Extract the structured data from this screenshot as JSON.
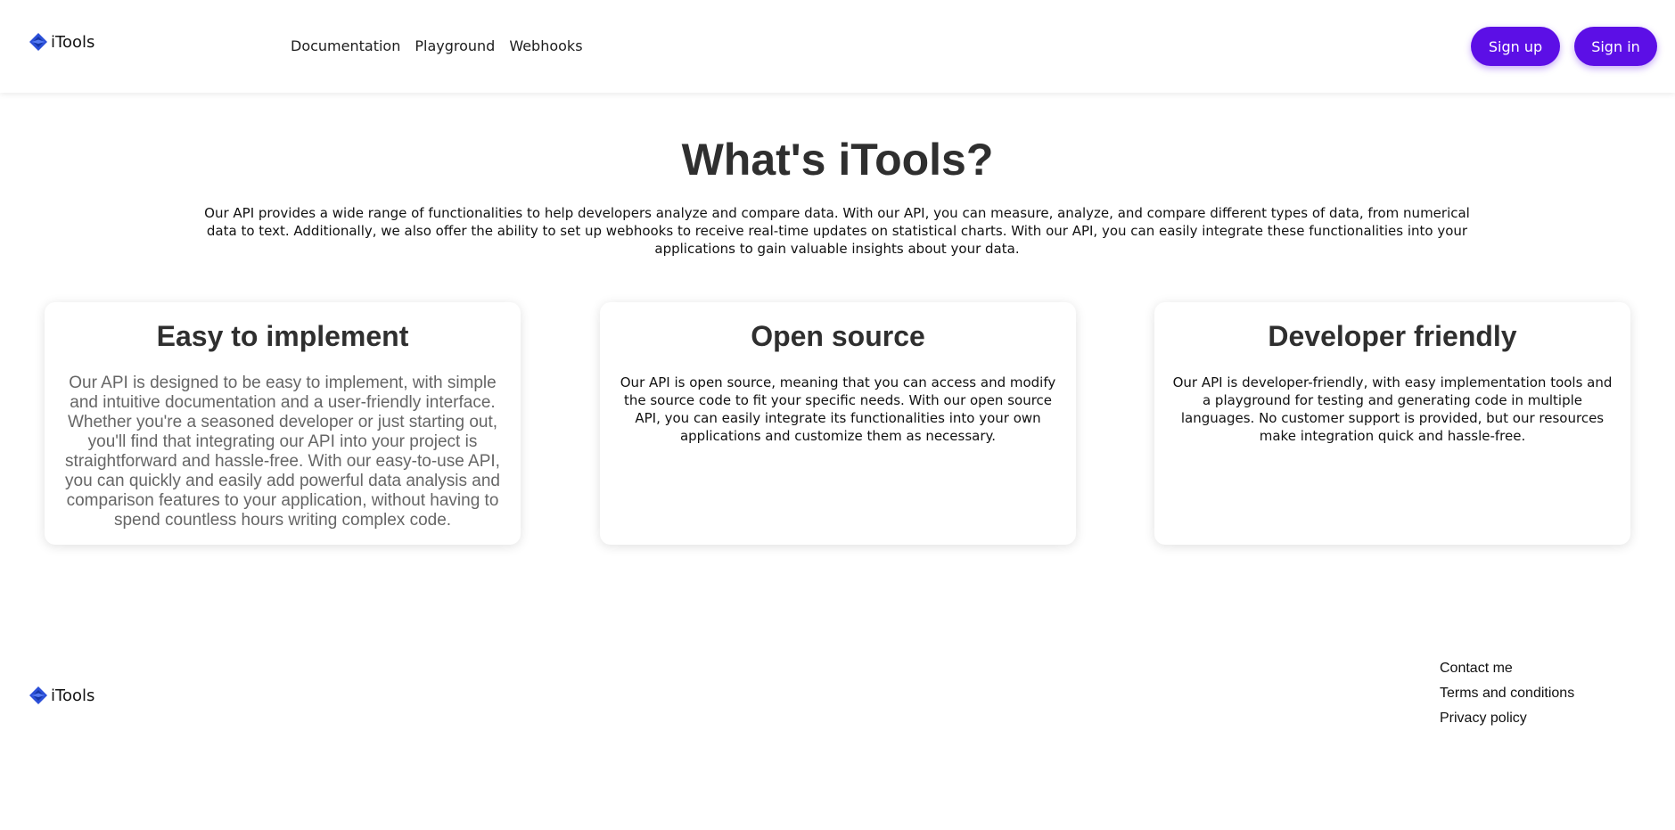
{
  "header": {
    "brand": "iTools",
    "nav": [
      "Documentation",
      "Playground",
      "Webhooks"
    ],
    "signup_label": "Sign up",
    "signin_label": "Sign in"
  },
  "hero": {
    "title": "What's iTools?",
    "description": "Our API provides a wide range of functionalities to help developers analyze and compare data. With our API, you can measure, analyze, and compare different types of data, from numerical data to text. Additionally, we also offer the ability to set up webhooks to receive real-time updates on statistical charts. With our API, you can easily integrate these functionalities into your applications to gain valuable insights about your data."
  },
  "cards": [
    {
      "title": "Easy to implement",
      "text": "Our API is designed to be easy to implement, with simple and intuitive documentation and a user-friendly interface. Whether you're a seasoned developer or just starting out, you'll find that integrating our API into your project is straightforward and hassle-free. With our easy-to-use API, you can quickly and easily add powerful data analysis and comparison features to your application, without having to spend countless hours writing complex code."
    },
    {
      "title": "Open source",
      "text": "Our API is open source, meaning that you can access and modify the source code to fit your specific needs. With our open source API, you can easily integrate its functionalities into your own applications and customize them as necessary."
    },
    {
      "title": "Developer friendly",
      "text": "Our API is developer-friendly, with easy implementation tools and a playground for testing and generating code in multiple languages. No customer support is provided, but our resources make integration quick and hassle-free."
    }
  ],
  "footer": {
    "brand": "iTools",
    "links": [
      "Contact me",
      "Terms and conditions",
      "Privacy policy"
    ]
  },
  "colors": {
    "accent": "#5c0fe6",
    "logo_blue": "#2b4fd8"
  },
  "icons": {
    "logo": "diamond-logo-icon"
  }
}
